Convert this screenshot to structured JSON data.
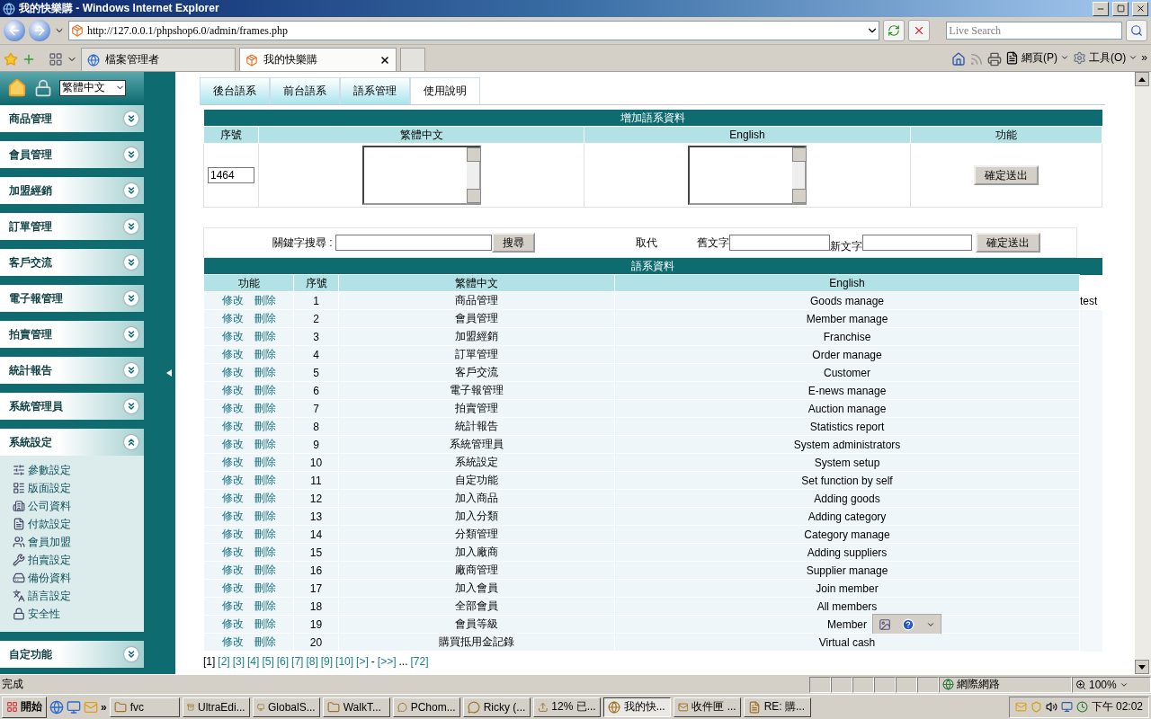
{
  "window": {
    "title": "我的快樂購 - Windows Internet Explorer"
  },
  "address_bar": {
    "url": "http://127.0.0.1/phpshop6.0/admin/frames.php"
  },
  "search": {
    "placeholder": "Live Search"
  },
  "browser_tabs": [
    {
      "label": "檔案管理者",
      "selected": false
    },
    {
      "label": "我的快樂購",
      "selected": true
    }
  ],
  "command_bar": {
    "items": [
      "網頁(P)",
      "工具(O)"
    ],
    "overflow": "»"
  },
  "sidebar": {
    "language": "繁體中文",
    "groups": [
      {
        "label": "商品管理",
        "expanded": false
      },
      {
        "label": "會員管理",
        "expanded": false
      },
      {
        "label": "加盟經銷",
        "expanded": false
      },
      {
        "label": "訂單管理",
        "expanded": false
      },
      {
        "label": "客戶交流",
        "expanded": false
      },
      {
        "label": "電子報管理",
        "expanded": false
      },
      {
        "label": "拍賣管理",
        "expanded": false
      },
      {
        "label": "統計報告",
        "expanded": false
      },
      {
        "label": "系統管理員",
        "expanded": false
      },
      {
        "label": "系統設定",
        "expanded": true,
        "children": [
          "參數設定",
          "版面設定",
          "公司資料",
          "付款設定",
          "會員加盟",
          "拍賣設定",
          "備份資料",
          "語言設定",
          "安全性"
        ]
      },
      {
        "label": "自定功能",
        "expanded": false
      }
    ]
  },
  "page_tabs": [
    {
      "label": "後台語系",
      "selected": false
    },
    {
      "label": "前台語系",
      "selected": false
    },
    {
      "label": "語系管理",
      "selected": false
    },
    {
      "label": "使用說明",
      "selected": true
    }
  ],
  "add_form": {
    "title": "增加語系資料",
    "columns": [
      "序號",
      "繁體中文",
      "English",
      "功能"
    ],
    "id_value": "1464",
    "submit": "確定送出"
  },
  "search_bar": {
    "keyword_label": "關鍵字搜尋 :",
    "search_button": "搜尋",
    "replace_label": "取代",
    "old_label": "舊文字",
    "new_label": "新文字",
    "submit": "確定送出"
  },
  "table": {
    "title": "語系資料",
    "columns": [
      "功能",
      "序號",
      "繁體中文",
      "English"
    ],
    "rows": [
      {
        "actions": [
          "修改",
          "刪除"
        ],
        "number": "1",
        "zh": "商品管理",
        "en": "Goods manage",
        "column_5": "test"
      },
      {
        "actions": [
          "修改",
          "刪除"
        ],
        "number": "2",
        "zh": "會員管理",
        "en": "Member manage"
      },
      {
        "actions": [
          "修改",
          "刪除"
        ],
        "number": "3",
        "zh": "加盟經銷",
        "en": "Franchise"
      },
      {
        "actions": [
          "修改",
          "刪除"
        ],
        "number": "4",
        "zh": "訂單管理",
        "en": "Order manage"
      },
      {
        "actions": [
          "修改",
          "刪除"
        ],
        "number": "5",
        "zh": "客戶交流",
        "en": "Customer"
      },
      {
        "actions": [
          "修改",
          "刪除"
        ],
        "number": "6",
        "zh": "電子報管理",
        "en": "E-news manage"
      },
      {
        "actions": [
          "修改",
          "刪除"
        ],
        "number": "7",
        "zh": "拍賣管理",
        "en": "Auction manage"
      },
      {
        "actions": [
          "修改",
          "刪除"
        ],
        "number": "8",
        "zh": "統計報告",
        "en": "Statistics report"
      },
      {
        "actions": [
          "修改",
          "刪除"
        ],
        "number": "9",
        "zh": "系統管理員",
        "en": "System administrators"
      },
      {
        "actions": [
          "修改",
          "刪除"
        ],
        "number": "10",
        "zh": "系統設定",
        "en": "System setup"
      },
      {
        "actions": [
          "修改",
          "刪除"
        ],
        "number": "11",
        "zh": "自定功能",
        "en": "Set function by self"
      },
      {
        "actions": [
          "修改",
          "刪除"
        ],
        "number": "12",
        "zh": "加入商品",
        "en": "Adding goods"
      },
      {
        "actions": [
          "修改",
          "刪除"
        ],
        "number": "13",
        "zh": "加入分類",
        "en": "Adding category"
      },
      {
        "actions": [
          "修改",
          "刪除"
        ],
        "number": "14",
        "zh": "分類管理",
        "en": "Category manage"
      },
      {
        "actions": [
          "修改",
          "刪除"
        ],
        "number": "15",
        "zh": "加入廠商",
        "en": "Adding suppliers"
      },
      {
        "actions": [
          "修改",
          "刪除"
        ],
        "number": "16",
        "zh": "廠商管理",
        "en": "Supplier manage"
      },
      {
        "actions": [
          "修改",
          "刪除"
        ],
        "number": "17",
        "zh": "加入會員",
        "en": "Join member"
      },
      {
        "actions": [
          "修改",
          "刪除"
        ],
        "number": "18",
        "zh": "全部會員",
        "en": "All members"
      },
      {
        "actions": [
          "修改",
          "刪除"
        ],
        "number": "19",
        "zh": "會員等級",
        "en": "Member",
        "image_toolbar": true
      },
      {
        "actions": [
          "修改",
          "刪除"
        ],
        "number": "20",
        "zh": "購買抵用金記錄",
        "en": "Virtual cash"
      }
    ]
  },
  "pagination": [
    {
      "kind": "link",
      "label": "[1]",
      "selected": true
    },
    {
      "kind": "link",
      "label": "[2]",
      "selected": false
    },
    {
      "kind": "link",
      "label": "[3]",
      "selected": false
    },
    {
      "kind": "link",
      "label": "[4]",
      "selected": false
    },
    {
      "kind": "link",
      "label": "[5]",
      "selected": false
    },
    {
      "kind": "link",
      "label": "[6]",
      "selected": false
    },
    {
      "kind": "link",
      "label": "[7]",
      "selected": false
    },
    {
      "kind": "link",
      "label": "[8]",
      "selected": false
    },
    {
      "kind": "link",
      "label": "[9]",
      "selected": false
    },
    {
      "kind": "link",
      "label": "[10]",
      "selected": false
    },
    {
      "kind": "link",
      "label": "[>]",
      "selected": false
    },
    {
      "kind": "text",
      "label": "-"
    },
    {
      "kind": "link",
      "label": "[>>]",
      "selected": false
    },
    {
      "kind": "text",
      "label": "..."
    },
    {
      "kind": "link",
      "label": "[72]",
      "selected": false
    }
  ],
  "status_bar": {
    "text": "完成",
    "zone": "網際網路",
    "zoom": "100%"
  },
  "taskbar": {
    "start": "開始",
    "quick_launch_overflow": "»",
    "tasks": [
      {
        "label": "fvc",
        "selected": false
      },
      {
        "label": "UltraEdi...",
        "selected": false
      },
      {
        "label": "GlobalS...",
        "selected": false
      },
      {
        "label": "WalkT...",
        "selected": false
      },
      {
        "label": "PChom...",
        "selected": false
      },
      {
        "label": "Ricky (...",
        "selected": false
      },
      {
        "label": "12% 已...",
        "selected": false
      },
      {
        "label": "我的快...",
        "selected": true
      },
      {
        "label": "收件匣 ...",
        "selected": false
      },
      {
        "label": "RE: 購...",
        "selected": false
      }
    ],
    "clock": "下午 02:02"
  }
}
